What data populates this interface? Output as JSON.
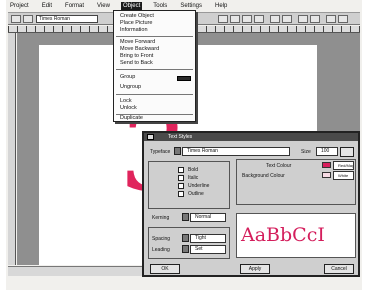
{
  "menubar": {
    "items": [
      "Project",
      "Edit",
      "Format",
      "View",
      "Object",
      "Tools",
      "Settings",
      "Help"
    ],
    "active_index": 4
  },
  "toolbar": {
    "field_text": "Times Roman"
  },
  "object_menu": {
    "items": [
      "Create Object",
      "Place Picture",
      "Information",
      "Move Forward",
      "Move Backward",
      "Bring to Front",
      "Send to Back",
      "Group",
      "Ungroup",
      "Lock",
      "Unlock",
      "Duplicate"
    ]
  },
  "page": {
    "big_digit": "3"
  },
  "dialog": {
    "title": "Text Styles",
    "style_label": "Typeface",
    "style_value": "Times Roman",
    "size_label": "Size",
    "size_value": "100",
    "options": [
      "Bold",
      "Italic",
      "Underline",
      "Outline"
    ],
    "kerning_label": "Kerning",
    "kerning_value": "Normal",
    "spacing_label": "Spacing",
    "spacing_value": "Tight",
    "leading_label": "Leading",
    "leading_value": "Set",
    "text_colour_label": "Text Colour",
    "text_colour_value": "Red/Magenta",
    "background_colour_label": "Background Colour",
    "background_colour_value": "White",
    "ok_label": "OK",
    "apply_label": "Apply",
    "cancel_label": "Cancel",
    "preview_text": "AaBbCcI"
  },
  "colors": {
    "accent": "#d41e5c",
    "accent_light": "#f7dbe4",
    "dialog_bg": "#cfcfcf",
    "pasteboard": "#8f8f8f"
  }
}
